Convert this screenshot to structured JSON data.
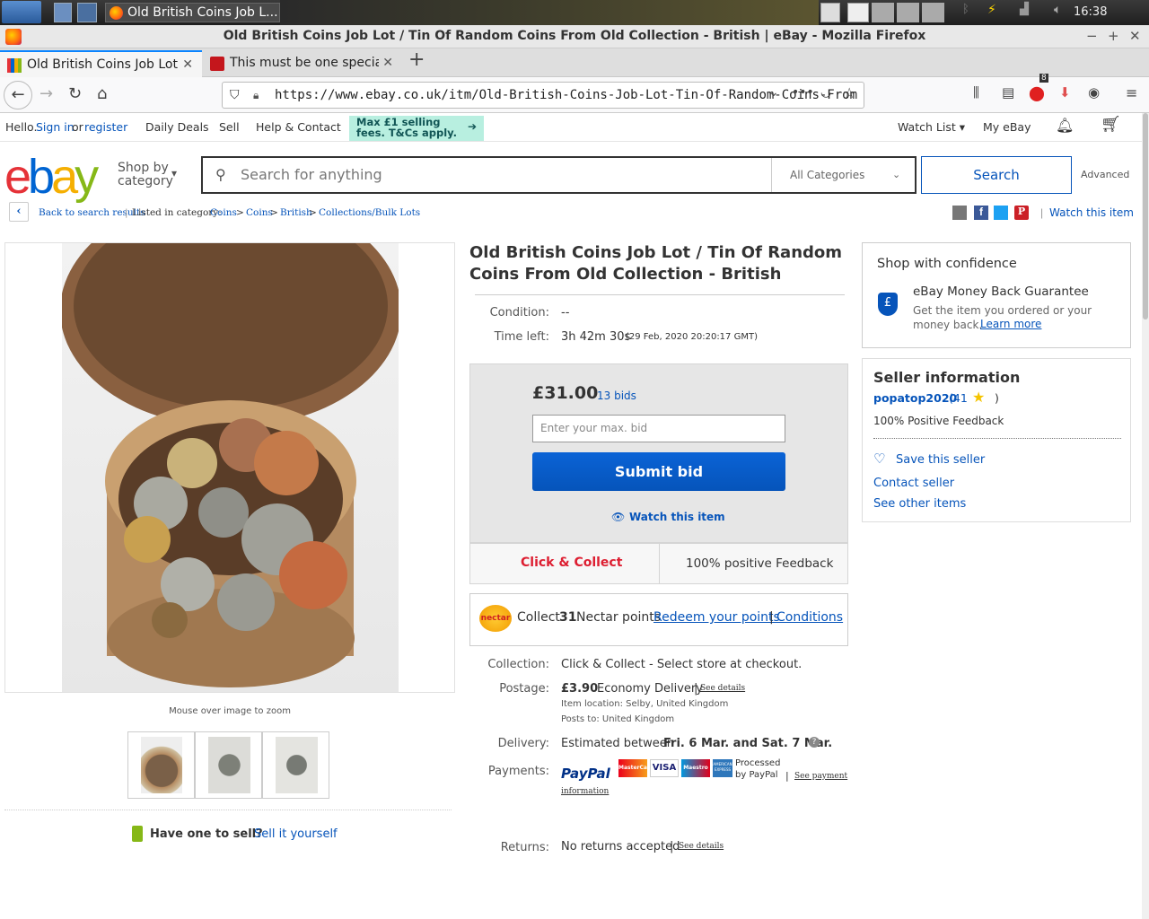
{
  "os": {
    "active_task_label": "Old British Coins Job L...",
    "clock": "16:38"
  },
  "window": {
    "title": "Old British Coins Job Lot / Tin Of Random Coins From Old Collection - British | eBay - Mozilla Firefox"
  },
  "tabs": [
    {
      "label": "Old British Coins Job Lot"
    },
    {
      "label": "This must be one special"
    }
  ],
  "url": "https://www.ebay.co.uk/itm/Old-British-Coins-Job-Lot-Tin-Of-Random-Coins-From",
  "toolbar_badge": "8",
  "topbar": {
    "hello": "Hello.",
    "sign_in": "Sign in",
    "or": "or",
    "register": "register",
    "daily_deals": "Daily Deals",
    "sell": "Sell",
    "help": "Help & Contact",
    "promo": "Max £1 selling fees. T&Cs apply.",
    "watch_list": "Watch List",
    "my_ebay": "My eBay"
  },
  "header": {
    "shop_by": "Shop by",
    "category": "category",
    "search_placeholder": "Search for anything",
    "all_categories": "All Categories",
    "search_button": "Search",
    "advanced": "Advanced"
  },
  "breadcrumb": {
    "back": "Back to search results",
    "listed_in": "Listed in category:",
    "items": [
      "Coins",
      "Coins",
      "British",
      "Collections/Bulk Lots"
    ],
    "watch": "Watch this item"
  },
  "gallery": {
    "zoom_hint": "Mouse over image to zoom",
    "have_one": "Have one to sell?",
    "sell_it": "Sell it yourself"
  },
  "item": {
    "title": "Old British Coins Job Lot / Tin Of Random Coins From Old Collection - British",
    "condition_label": "Condition:",
    "condition_value": "--",
    "time_left_label": "Time left:",
    "time_left_value": "3h 42m 30s",
    "end_time": "(29 Feb, 2020  20:20:17 GMT)",
    "price": "£31.00",
    "bids": "13 bids",
    "bid_placeholder": "Enter your max. bid",
    "submit": "Submit bid",
    "watch": "Watch this item",
    "click_collect": "Click & Collect",
    "positive": "100% positive Feedback",
    "nectar_collect": "Collect",
    "nectar_points": "31",
    "nectar_text": "Nectar points",
    "redeem": "Redeem your points",
    "conditions": "Conditions",
    "nectar_logo": "nectar",
    "collection_label": "Collection:",
    "collection_value": "Click & Collect - Select store at checkout.",
    "postage_label": "Postage:",
    "postage_price": "£3.90",
    "postage_service": "Economy Delivery",
    "see_details": "See details",
    "item_location": "Item location:  Selby, United Kingdom",
    "posts_to": "Posts to:  United Kingdom",
    "delivery_label": "Delivery:",
    "delivery_prefix": "Estimated between",
    "delivery_dates": "Fri. 6 Mar. and Sat. 7 Mar.",
    "payments_label": "Payments:",
    "paypal": "PayPal",
    "processed": "Processed",
    "by_paypal": "by PayPal",
    "see_payment": "See payment",
    "information": "information",
    "returns_label": "Returns:",
    "returns_value": "No returns accepted",
    "returns_details": "See details",
    "card_mastercard": "MasterCard",
    "card_visa": "VISA",
    "card_maestro": "Maestro",
    "card_amex": "AMERICAN EXPRESS"
  },
  "confidence": {
    "heading": "Shop with confidence",
    "guarantee": "eBay Money Back Guarantee",
    "guarantee_text": "Get the item you ordered or your money back.",
    "learn_more": "Learn more"
  },
  "seller": {
    "heading": "Seller information",
    "name": "popatop2020",
    "feedback_count": "(41",
    "close_paren": ")",
    "positive": "100% Positive Feedback",
    "save": "Save this seller",
    "contact": "Contact seller",
    "other": "See other items"
  },
  "colors": {
    "ebay_red": "#e53238",
    "ebay_blue": "#0064d2",
    "ebay_yellow": "#f5af02",
    "ebay_green": "#86b817",
    "link": "#0654ba",
    "click_collect": "#dd1e31"
  }
}
